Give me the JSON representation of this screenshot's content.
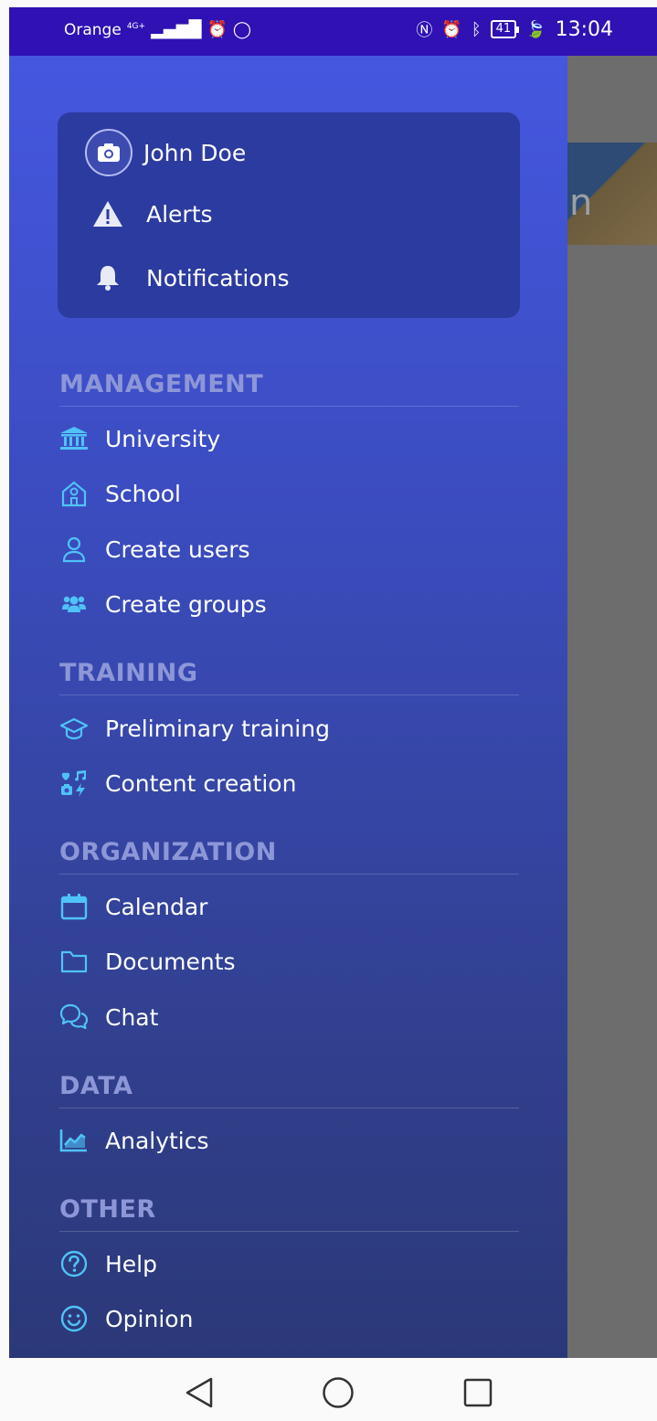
{
  "status_bar": {
    "carrier": "Orange",
    "network": "4G+",
    "time": "13:04",
    "battery": "41"
  },
  "profile": {
    "name": "John Doe",
    "alerts_label": "Alerts",
    "notifications_label": "Notifications"
  },
  "sections": {
    "management": {
      "title": "MANAGEMENT",
      "items": [
        "University",
        "School",
        "Create users",
        "Create groups"
      ]
    },
    "training": {
      "title": "TRAINING",
      "items": [
        "Preliminary training",
        "Content creation"
      ]
    },
    "organization": {
      "title": "ORGANIZATION",
      "items": [
        "Calendar",
        "Documents",
        "Chat"
      ]
    },
    "data": {
      "title": "DATA",
      "items": [
        "Analytics"
      ]
    },
    "other": {
      "title": "OTHER",
      "items": [
        "Help",
        "Opinion"
      ]
    }
  },
  "background_app": {
    "partial_text": "n"
  },
  "colors": {
    "status_bar": "#2f11b4",
    "drawer_top": "#4557df",
    "drawer_bottom": "#2b3878",
    "card": "#2c3ba0",
    "section_title": "#8d97d8",
    "icon_accent": "#4fc3f7"
  }
}
